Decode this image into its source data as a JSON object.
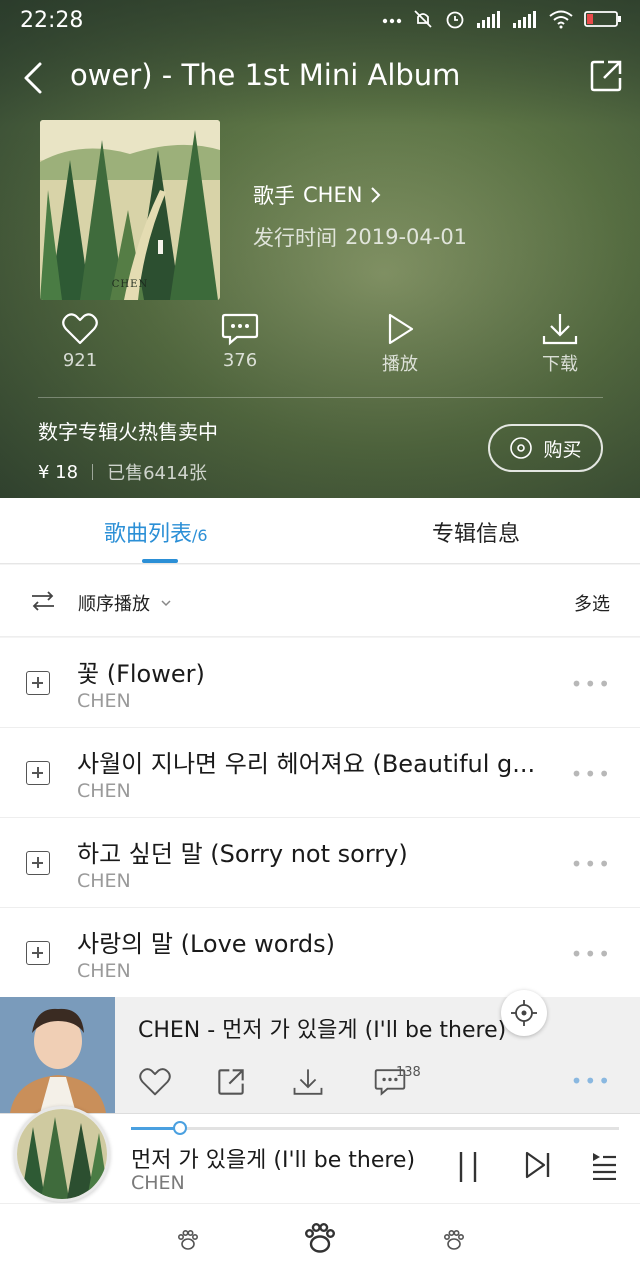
{
  "status_bar": {
    "time": "22:28"
  },
  "header": {
    "title": "ower) - The 1st Mini Album",
    "cover_label": "CHEN",
    "artist_label": "歌手",
    "artist_name": "CHEN",
    "release_label": "发行时间",
    "release_date": "2019-04-01"
  },
  "actions": [
    {
      "icon": "heart-icon",
      "label": "921"
    },
    {
      "icon": "comment-icon",
      "label": "376"
    },
    {
      "icon": "play-icon",
      "label": "播放"
    },
    {
      "icon": "download-icon",
      "label": "下载"
    }
  ],
  "promo": {
    "title": "数字专辑火热售卖中",
    "price": "¥ 18",
    "sold": "已售6414张",
    "buy_label": "购买"
  },
  "tabs": {
    "songs_label": "歌曲列表",
    "songs_count": "/6",
    "info_label": "专辑信息",
    "active": "songs"
  },
  "playmode": {
    "label": "顺序播放",
    "multi_select": "多选"
  },
  "songs": [
    {
      "title": "꽃 (Flower)",
      "artist": "CHEN"
    },
    {
      "title": "사월이 지나면 우리 헤어져요 (Beautiful g...",
      "artist": "CHEN"
    },
    {
      "title": "하고 싶던 말 (Sorry not sorry)",
      "artist": "CHEN"
    },
    {
      "title": "사랑의 말 (Love words)",
      "artist": "CHEN"
    }
  ],
  "popup": {
    "title": "CHEN - 먼저 가 있을게 (I'll be there)",
    "comment_count": "138"
  },
  "player": {
    "title": "먼저 가 있을게 (I'll be there)",
    "artist": "CHEN",
    "progress": 0.1
  },
  "colors": {
    "accent": "#2b8fd6",
    "header_green": "#5a7244"
  }
}
